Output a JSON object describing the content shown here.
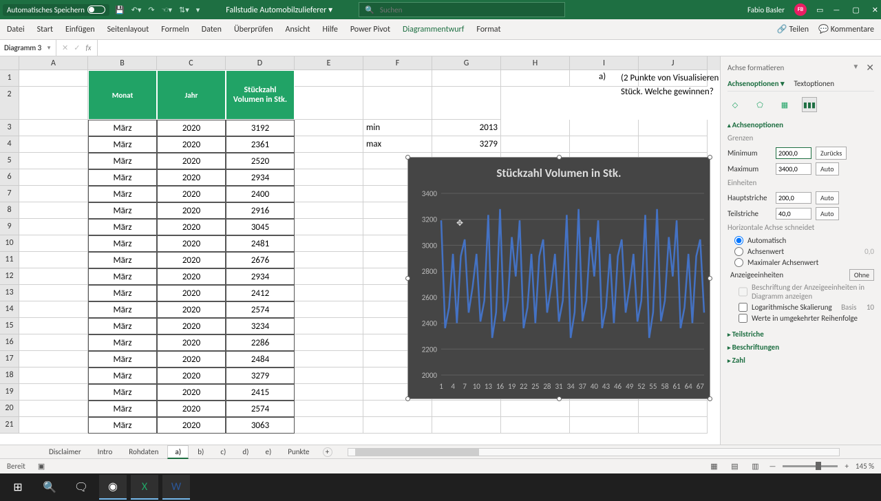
{
  "titlebar": {
    "autosave": "Automatisches Speichern",
    "docname": "Fallstudie Automobilzulieferer ▾",
    "search_placeholder": "Suchen",
    "user": "Fabio Basler",
    "initials": "FB"
  },
  "ribbon": {
    "tabs": [
      "Datei",
      "Start",
      "Einfügen",
      "Seitenlayout",
      "Formeln",
      "Daten",
      "Überprüfen",
      "Ansicht",
      "Hilfe",
      "Power Pivot",
      "Diagrammentwurf",
      "Format"
    ],
    "active": "Diagrammentwurf",
    "share": "Teilen",
    "comments": "Kommentare"
  },
  "namebox": "Diagramm 3",
  "columns": [
    "A",
    "B",
    "C",
    "D",
    "E",
    "F",
    "G",
    "H",
    "I",
    "J"
  ],
  "table": {
    "hdr": [
      "Monat",
      "Jahr",
      "Stückzahl Volumen in Stk."
    ],
    "rows": [
      [
        "März",
        "2020",
        "3192"
      ],
      [
        "März",
        "2020",
        "2361"
      ],
      [
        "März",
        "2020",
        "2520"
      ],
      [
        "März",
        "2020",
        "2934"
      ],
      [
        "März",
        "2020",
        "2400"
      ],
      [
        "März",
        "2020",
        "2916"
      ],
      [
        "März",
        "2020",
        "3045"
      ],
      [
        "März",
        "2020",
        "2481"
      ],
      [
        "März",
        "2020",
        "2676"
      ],
      [
        "März",
        "2020",
        "2934"
      ],
      [
        "März",
        "2020",
        "2412"
      ],
      [
        "März",
        "2020",
        "2574"
      ],
      [
        "März",
        "2020",
        "3234"
      ],
      [
        "März",
        "2020",
        "2286"
      ],
      [
        "März",
        "2020",
        "2484"
      ],
      [
        "März",
        "2020",
        "3279"
      ],
      [
        "März",
        "2020",
        "2415"
      ],
      [
        "März",
        "2020",
        "2574"
      ],
      [
        "März",
        "2020",
        "3063"
      ]
    ]
  },
  "stats": {
    "min_label": "min",
    "min_val": "2013",
    "max_label": "max",
    "max_val": "3279"
  },
  "question": {
    "marker": "a)",
    "text": "(2 Punkte von Visualisieren S Stück. Welche gewinnen?"
  },
  "chart_data": {
    "type": "line",
    "title": "Stückzahl Volumen in Stk.",
    "ylabel": "",
    "xlabel": "",
    "ylim": [
      2000,
      3400
    ],
    "yticks": [
      2000,
      2200,
      2400,
      2600,
      2800,
      3000,
      3200,
      3400
    ],
    "xticks": [
      1,
      4,
      7,
      10,
      13,
      16,
      19,
      22,
      25,
      28,
      31,
      34,
      37,
      40,
      43,
      46,
      49,
      52,
      55,
      58,
      61,
      64,
      67
    ],
    "values": [
      3192,
      2361,
      2520,
      2934,
      2400,
      2916,
      3045,
      2481,
      2676,
      2934,
      2412,
      2574,
      3234,
      2286,
      2484,
      3279,
      2415,
      2574,
      3063,
      2760,
      3192,
      2361,
      2520,
      2934,
      2400,
      2916,
      3045,
      2481,
      2676,
      2934,
      2412,
      2574,
      3234,
      2286,
      2484,
      3279,
      2415,
      2574,
      3063,
      2760,
      3192,
      2361,
      2520,
      2934,
      2400,
      2916,
      3045,
      2481,
      2676,
      2934,
      2412,
      2574,
      3234,
      2286,
      2484,
      3279,
      2415,
      2574,
      3063,
      2760,
      3192,
      2361,
      2520,
      2934,
      2400,
      2916,
      3045,
      2481
    ]
  },
  "pane": {
    "title": "Achse formatieren",
    "tabs": [
      "Achsenoptionen",
      "Textoptionen"
    ],
    "section": "Achsenoptionen",
    "grenzen": "Grenzen",
    "min_l": "Minimum",
    "min_v": "2000,0",
    "reset": "Zurücks",
    "max_l": "Maximum",
    "max_v": "3400,0",
    "auto": "Auto",
    "einheiten": "Einheiten",
    "haupt_l": "Hauptstriche",
    "haupt_v": "200,0",
    "teil_l": "Teilstriche",
    "teil_v": "40,0",
    "hachse": "Horizontale Achse schneidet",
    "r1": "Automatisch",
    "r2": "Achsenwert",
    "r2v": "0,0",
    "r3": "Maximaler Achsenwert",
    "anzeige": "Anzeigeeinheiten",
    "ohne": "Ohne",
    "c1": "Beschriftung der Anzeigeeinheiten in Diagramm anzeigen",
    "c2": "Logarithmische Skalierung",
    "basis": "Basis",
    "basisv": "10",
    "c3": "Werte in umgekehrter Reihenfolge",
    "sec2": "Teilstriche",
    "sec3": "Beschriftungen",
    "sec4": "Zahl"
  },
  "sheets": [
    "Disclaimer",
    "Intro",
    "Rohdaten",
    "a)",
    "b)",
    "c)",
    "d)",
    "e)",
    "Punkte"
  ],
  "active_sheet": "a)",
  "status": "Bereit",
  "zoom": "145 %"
}
